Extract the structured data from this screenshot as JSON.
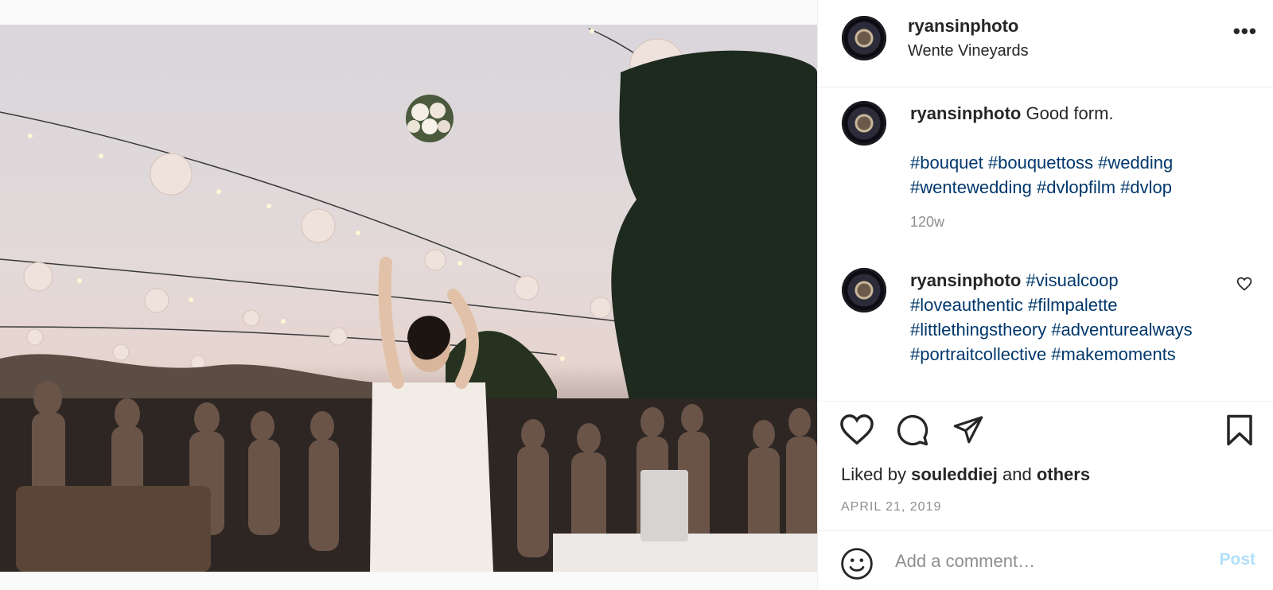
{
  "photo": {
    "alt_subject": "bouquet-toss"
  },
  "post": {
    "username": "ryansinphoto",
    "location": "Wente Vineyards",
    "more_icon": "more-horizontal-icon"
  },
  "comments": [
    {
      "username": "ryansinphoto",
      "text": "Good form.",
      "tags": "#bouquet #bouquettoss #wedding #wentewedding #dvlopfilm #dvlop",
      "time": "120w"
    },
    {
      "username": "ryansinphoto",
      "tags": "#visualcoop #loveauthentic #filmpalette #littlethingstheory #adventurealways #portraitcollective #makemoments"
    }
  ],
  "actions": {
    "like_icon": "heart-icon",
    "comment_icon": "comment-bubble-icon",
    "share_icon": "paper-plane-icon",
    "save_icon": "bookmark-icon"
  },
  "likes": {
    "prefix": "Liked by",
    "user": "souleddiej",
    "joiner": "and",
    "others": "others"
  },
  "date": "APRIL 21, 2019",
  "add_comment": {
    "placeholder": "Add a comment…",
    "post_label": "Post"
  },
  "colors": {
    "link": "#00376b",
    "muted": "#8e8e8e",
    "post_disabled": "#b2dffc",
    "border": "#efefef"
  }
}
